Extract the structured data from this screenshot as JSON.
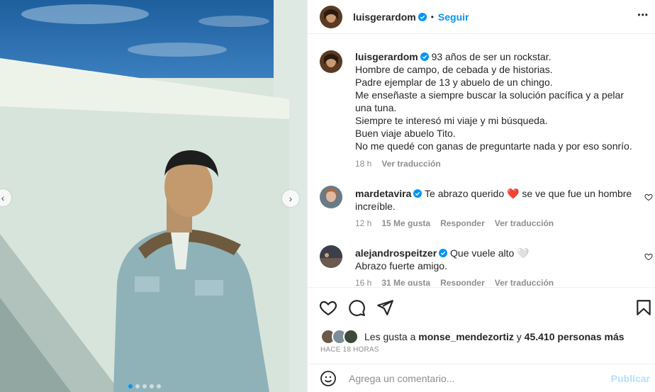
{
  "post": {
    "dots_count": 5,
    "active_dot": 0
  },
  "header": {
    "username": "luisgerardom",
    "separator": "•",
    "follow_label": "Seguir",
    "more_label": "•••"
  },
  "caption": {
    "username": "luisgerardom",
    "text": "93 años de ser un rockstar.\nHombre de campo, de cebada y de historias.\nPadre ejemplar de 13 y abuelo de un chingo.\nMe enseñaste a siempre buscar la solución pacífica y a pelar una tuna.\nSiempre te interesó mi viaje y mi búsqueda.\nBuen viaje abuelo Tito.\nNo me quedé con ganas de preguntarte nada y por eso sonrío.",
    "time": "18 h",
    "translate": "Ver traducción"
  },
  "comments": [
    {
      "username": "mardetavira",
      "text_before": "Te abrazo querido",
      "emoji": "❤️",
      "text_after": "se ve que fue un hombre increíble.",
      "time": "12 h",
      "likes": "15 Me gusta",
      "reply": "Responder",
      "translate": "Ver traducción"
    },
    {
      "username": "alejandrospeitzer",
      "text_before": "Que vuele alto",
      "emoji": "🤍",
      "text_after": "Abrazo fuerte amigo.",
      "time": "16 h",
      "likes": "31 Me gusta",
      "reply": "Responder",
      "translate": "Ver traducción"
    }
  ],
  "likes": {
    "prefix": "Les gusta a",
    "user": "monse_mendezortiz",
    "middle": "y",
    "count": "45.410 personas más"
  },
  "timestamp": "HACE 18 HORAS",
  "add_comment": {
    "placeholder": "Agrega un comentario...",
    "publish_label": "Publicar"
  },
  "icons": {
    "verified_color": "#0095f6",
    "emoji_icon": "smiley-icon"
  }
}
